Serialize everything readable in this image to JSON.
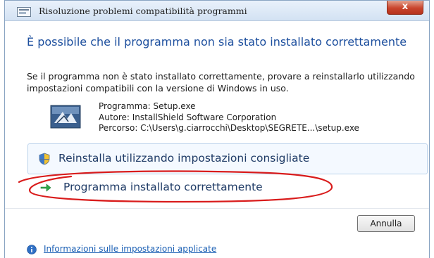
{
  "window": {
    "title": "Risoluzione problemi compatibilità programmi",
    "close_label": "x"
  },
  "main": {
    "heading": "È possibile che il programma non sia stato installato correttamente",
    "description": "Se il programma non è stato installato correttamente, provare a reinstallarlo utilizzando impostazioni compatibili con la versione di Windows in uso.",
    "program": "Programma: Setup.exe",
    "author": "Autore: InstallShield Software Corporation",
    "path": "Percorso: C:\\Users\\g.ciarrocchi\\Desktop\\SEGRETE...\\setup.exe"
  },
  "options": {
    "reinstall_label": "Reinstalla utilizzando impostazioni consigliate",
    "installed_ok_label": "Programma installato correttamente"
  },
  "footer": {
    "cancel_label": "Annulla",
    "info_link": "Informazioni sulle impostazioni applicate"
  },
  "icons": {
    "title": "window-icon",
    "program": "installshield-program-icon",
    "reinstall": "uac-shield-icon",
    "installed_ok": "green-arrow-icon",
    "info": "info-icon"
  },
  "colors": {
    "heading": "#1d4f9e",
    "link": "#1a5fb4",
    "annotation": "#d91c1c",
    "close_button": "#c9452d"
  }
}
